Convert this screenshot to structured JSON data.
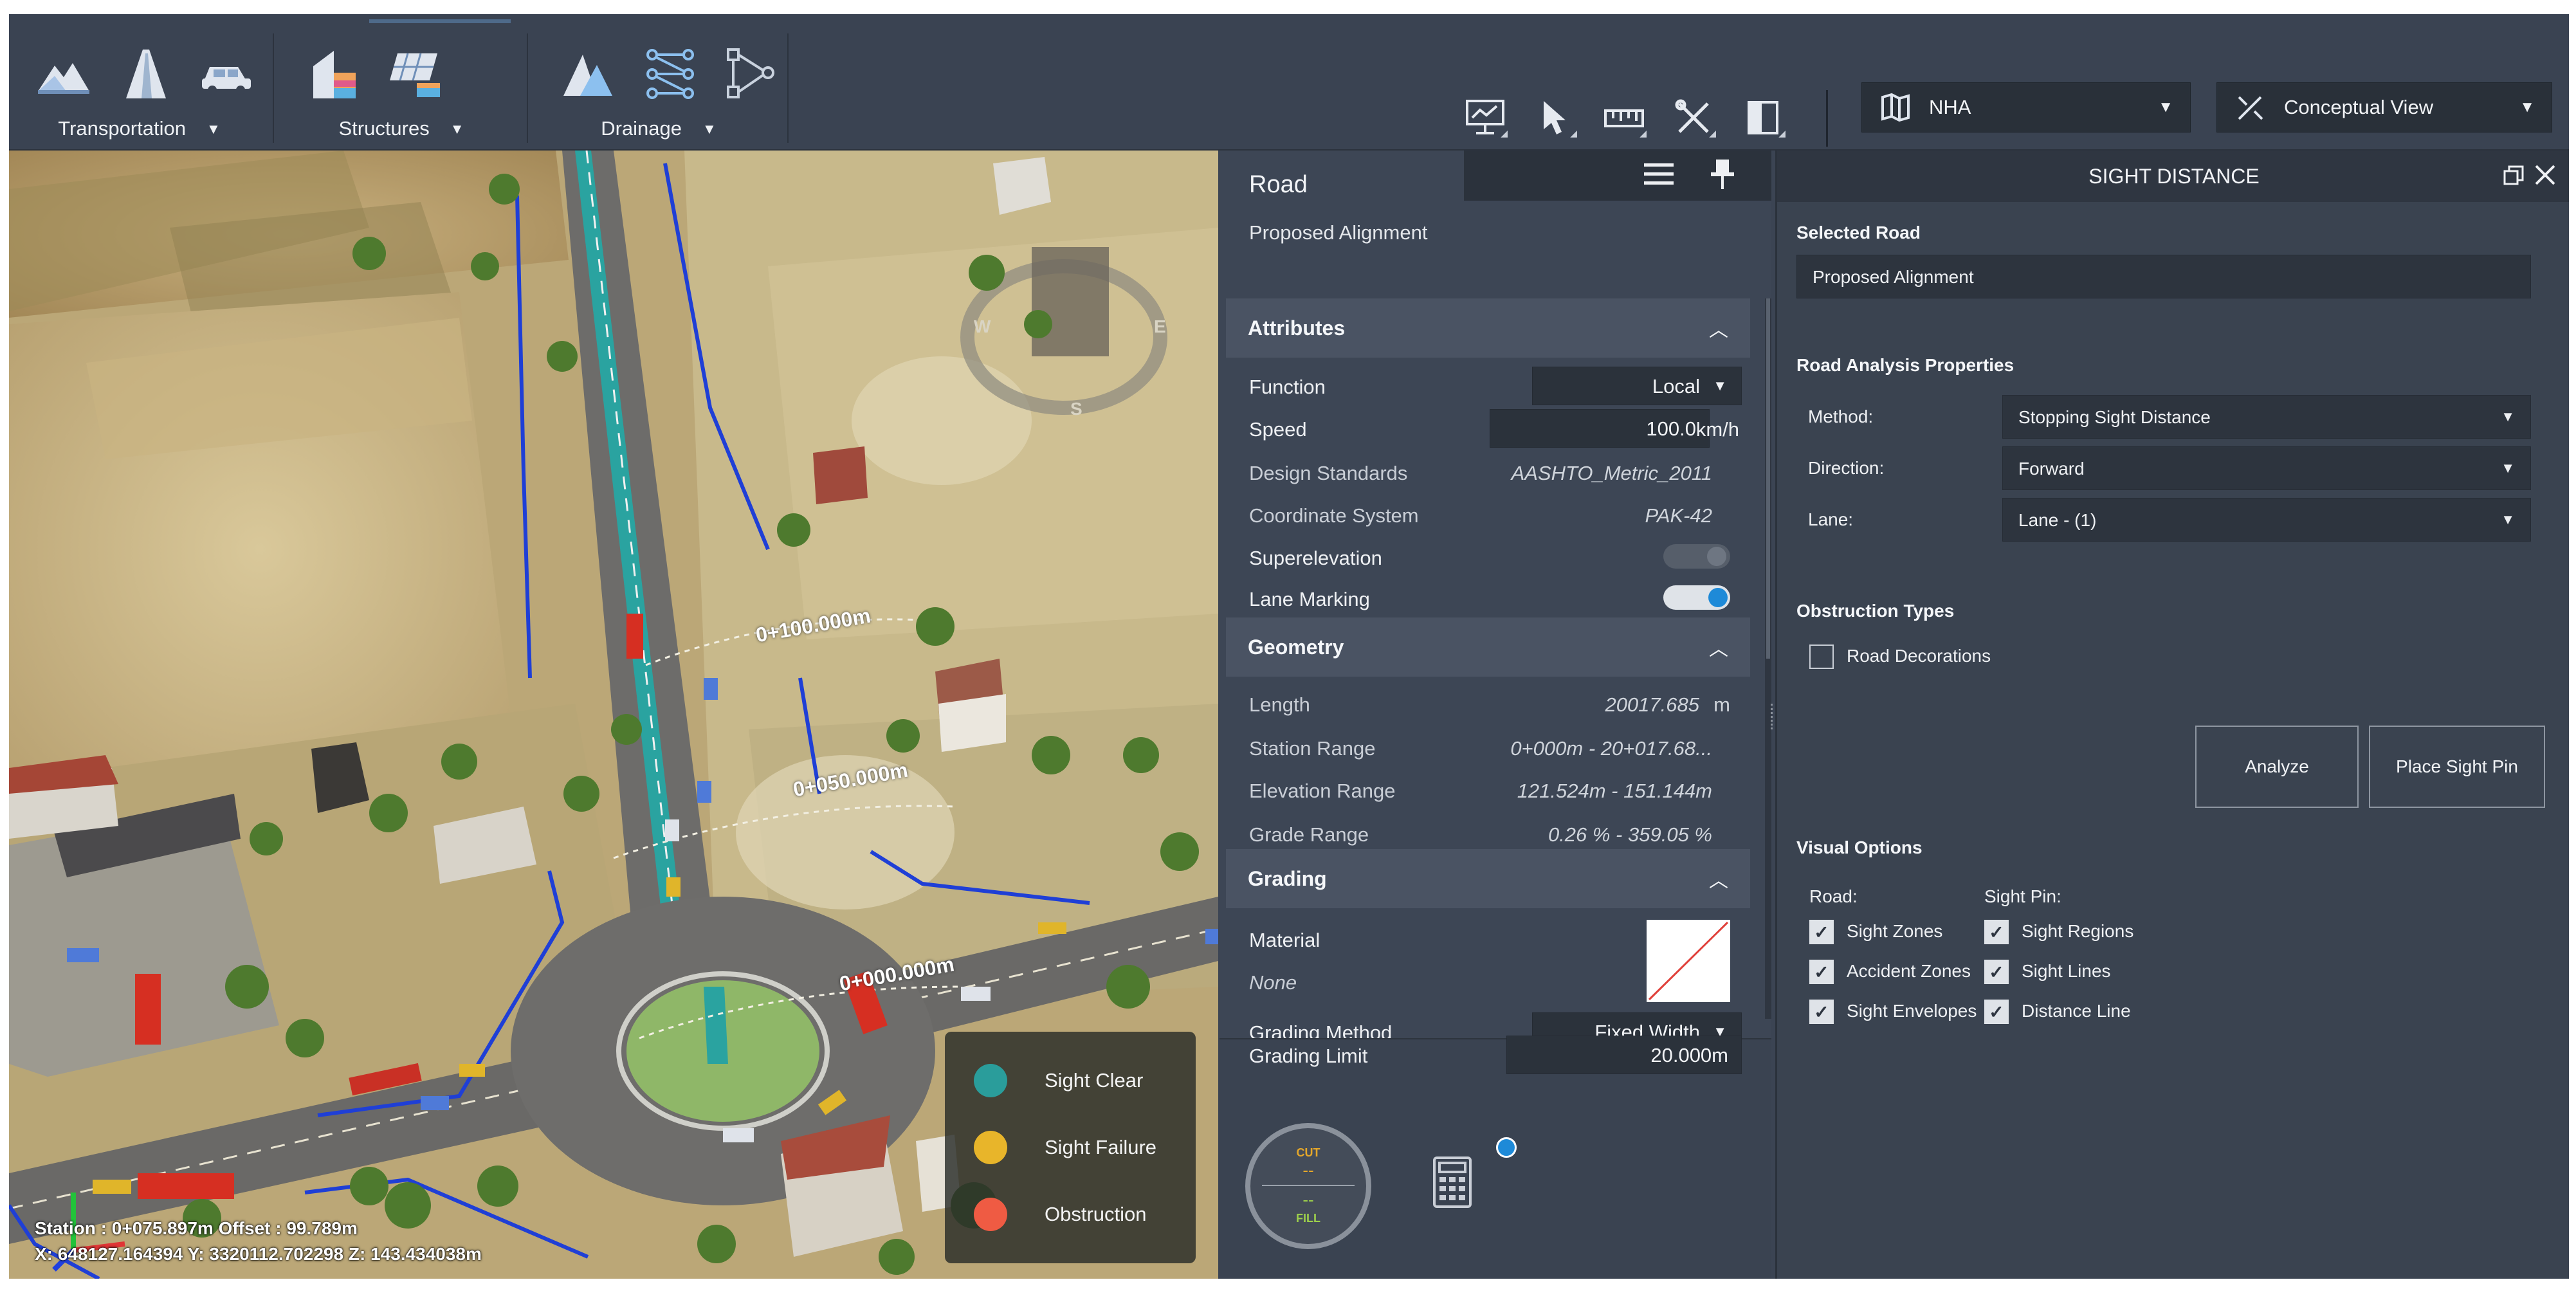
{
  "toolbar": {
    "groups": [
      {
        "label": "Transportation",
        "icons": [
          "terrain-icon",
          "road-icon",
          "vehicle-icon"
        ]
      },
      {
        "label": "Structures",
        "icons": [
          "building-icon",
          "solar-panel-icon"
        ]
      },
      {
        "label": "Drainage",
        "icons": [
          "water-drop-icon",
          "pipe-network-icon",
          "flow-icon"
        ]
      }
    ],
    "right_tools": [
      "presentation-icon",
      "select-pointer-icon",
      "measure-icon",
      "tools-icon",
      "panel-icon"
    ],
    "project_dropdown": "NHA",
    "view_dropdown": "Conceptual View"
  },
  "viewport": {
    "labels": [
      "0+100.000m",
      "0+050.000m",
      "0+000.000m"
    ],
    "compass": [
      "W",
      "E",
      "S"
    ],
    "station_line": "Station : 0+075.897m Offset : 99.789m",
    "xyz_line": "X: 648127.164394 Y: 3320112.702298 Z: 143.434038m",
    "legend": [
      {
        "label": "Sight Clear",
        "color": "#2a9d9b"
      },
      {
        "label": "Sight Failure",
        "color": "#e8b52a"
      },
      {
        "label": "Obstruction",
        "color": "#ef5b43"
      }
    ]
  },
  "road_panel": {
    "title": "Road",
    "subtitle": "Proposed Alignment",
    "attributes": {
      "title": "Attributes",
      "function_label": "Function",
      "function_value": "Local",
      "speed_label": "Speed",
      "speed_value": "100.0",
      "speed_unit": "km/h",
      "design_label": "Design Standards",
      "design_value": "AASHTO_Metric_2011",
      "coord_label": "Coordinate System",
      "coord_value": "PAK-42",
      "super_label": "Superelevation",
      "lane_label": "Lane Marking"
    },
    "geometry": {
      "title": "Geometry",
      "length_label": "Length",
      "length_value": "20017.685",
      "length_unit": "m",
      "station_label": "Station Range",
      "station_value": "0+000m - 20+017.68...",
      "elev_label": "Elevation Range",
      "elev_value": "121.524m - 151.144m",
      "grade_label": "Grade Range",
      "grade_value": "0.26 % - 359.05 %"
    },
    "grading": {
      "title": "Grading",
      "material_label": "Material",
      "material_value": "None",
      "method_label": "Grading Method",
      "method_value": "Fixed Width",
      "limit_label": "Grading Limit",
      "limit_value": "20.000m"
    },
    "gauge": {
      "cut": "CUT",
      "cut_value": "--",
      "fill": "FILL",
      "fill_value": "--"
    }
  },
  "sight_panel": {
    "title": "SIGHT DISTANCE",
    "selected_road_label": "Selected Road",
    "selected_road_value": "Proposed Alignment",
    "props_label": "Road Analysis Properties",
    "method_label": "Method:",
    "method_value": "Stopping Sight Distance",
    "direction_label": "Direction:",
    "direction_value": "Forward",
    "lane_label": "Lane:",
    "lane_value": "Lane - (1)",
    "obstruction_label": "Obstruction Types",
    "road_decorations": "Road Decorations",
    "analyze_button": "Analyze",
    "place_pin_button": "Place Sight Pin",
    "visual_label": "Visual Options",
    "road_col": "Road:",
    "pin_col": "Sight Pin:",
    "road_options": [
      "Sight Zones",
      "Accident Zones",
      "Sight Envelopes"
    ],
    "pin_options": [
      "Sight Regions",
      "Sight Lines",
      "Distance Line"
    ]
  }
}
